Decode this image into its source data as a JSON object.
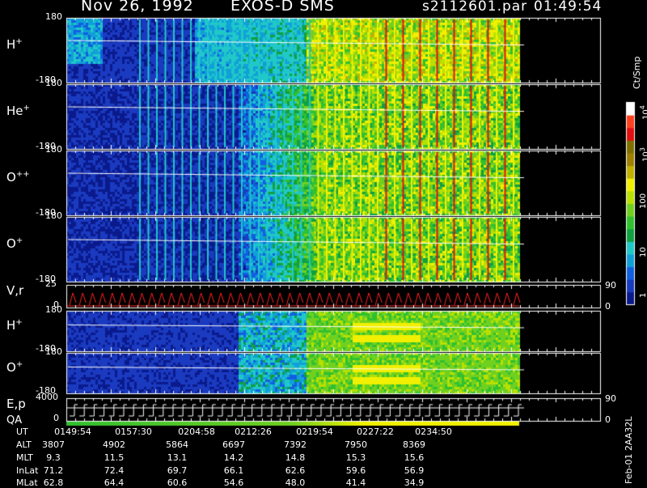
{
  "header": {
    "date": "Nov 26, 1992",
    "mission": "EXOS-D SMS",
    "file": "s2112601.par",
    "time": "01:49:54"
  },
  "colorbar": {
    "unit": "Ct/Smp",
    "labels": [
      "1",
      "10",
      "100",
      "10",
      "10"
    ],
    "exponents": [
      "3",
      "4"
    ],
    "colors": [
      "#0a1a8c",
      "#1a3ac0",
      "#1060e0",
      "#10a0d8",
      "#20c8c8",
      "#10a040",
      "#30c030",
      "#70d020",
      "#b8e000",
      "#f0f000",
      "#c0b000",
      "#a08000",
      "#807000",
      "#e01010",
      "#ff4020",
      "#ffffff"
    ]
  },
  "side_note": "Feb-01 2AA32L",
  "panels": [
    {
      "label": "H",
      "sup": "+",
      "ytop": "180",
      "ybot": "-180",
      "type": "pitch"
    },
    {
      "label": "He",
      "sup": "+",
      "ytop": "180",
      "ybot": "-180",
      "type": "pitch"
    },
    {
      "label": "O",
      "sup": "++",
      "ytop": "180",
      "ybot": "-180",
      "type": "pitch"
    },
    {
      "label": "O",
      "sup": "+",
      "ytop": "180",
      "ybot": "-180",
      "type": "pitch"
    },
    {
      "label": "V,r",
      "sup": "",
      "ytop": "25",
      "ybot": "0",
      "type": "line",
      "right_top": "90",
      "right_bot": "0"
    },
    {
      "label": "H",
      "sup": "+",
      "ytop": "180",
      "ybot": "-180",
      "type": "pitch2"
    },
    {
      "label": "O",
      "sup": "+",
      "ytop": "180",
      "ybot": "-180",
      "type": "pitch2"
    },
    {
      "label": "E,p",
      "label2": "QA",
      "sup": "",
      "ytop": "4000",
      "ybot": "0",
      "type": "step",
      "right_top": "90",
      "right_bot": "0"
    }
  ],
  "footer": {
    "row_labels": [
      "UT",
      "ALT",
      "MLT",
      "InLat",
      "MLat"
    ],
    "columns": [
      [
        "0149:54",
        "3807",
        "9.3",
        "71.2",
        "62.8"
      ],
      [
        "0157:30",
        "4902",
        "11.5",
        "72.4",
        "64.4"
      ],
      [
        "0204:58",
        "5864",
        "13.1",
        "69.7",
        "60.6"
      ],
      [
        "0212:26",
        "6697",
        "14.2",
        "66.1",
        "54.6"
      ],
      [
        "0219:54",
        "7392",
        "14.8",
        "62.6",
        "48.0"
      ],
      [
        "0227:22",
        "7950",
        "15.3",
        "59.6",
        "41.4"
      ],
      [
        "0234:50",
        "8369",
        "15.6",
        "56.9",
        "34.9"
      ]
    ]
  },
  "chart_data": {
    "type": "heatmap",
    "title": "Nov 26, 1992   EXOS-D SMS",
    "x_ticks": [
      "0149:54",
      "0157:30",
      "0204:58",
      "0212:26",
      "0219:54",
      "0227:22",
      "0234:50"
    ],
    "ylim_pitch": [
      -180,
      180
    ],
    "ylim_vr": [
      0,
      25
    ],
    "ylim_ep": [
      0,
      4000
    ],
    "colorscale": "log",
    "colorbar_range": [
      1,
      10000
    ]
  }
}
